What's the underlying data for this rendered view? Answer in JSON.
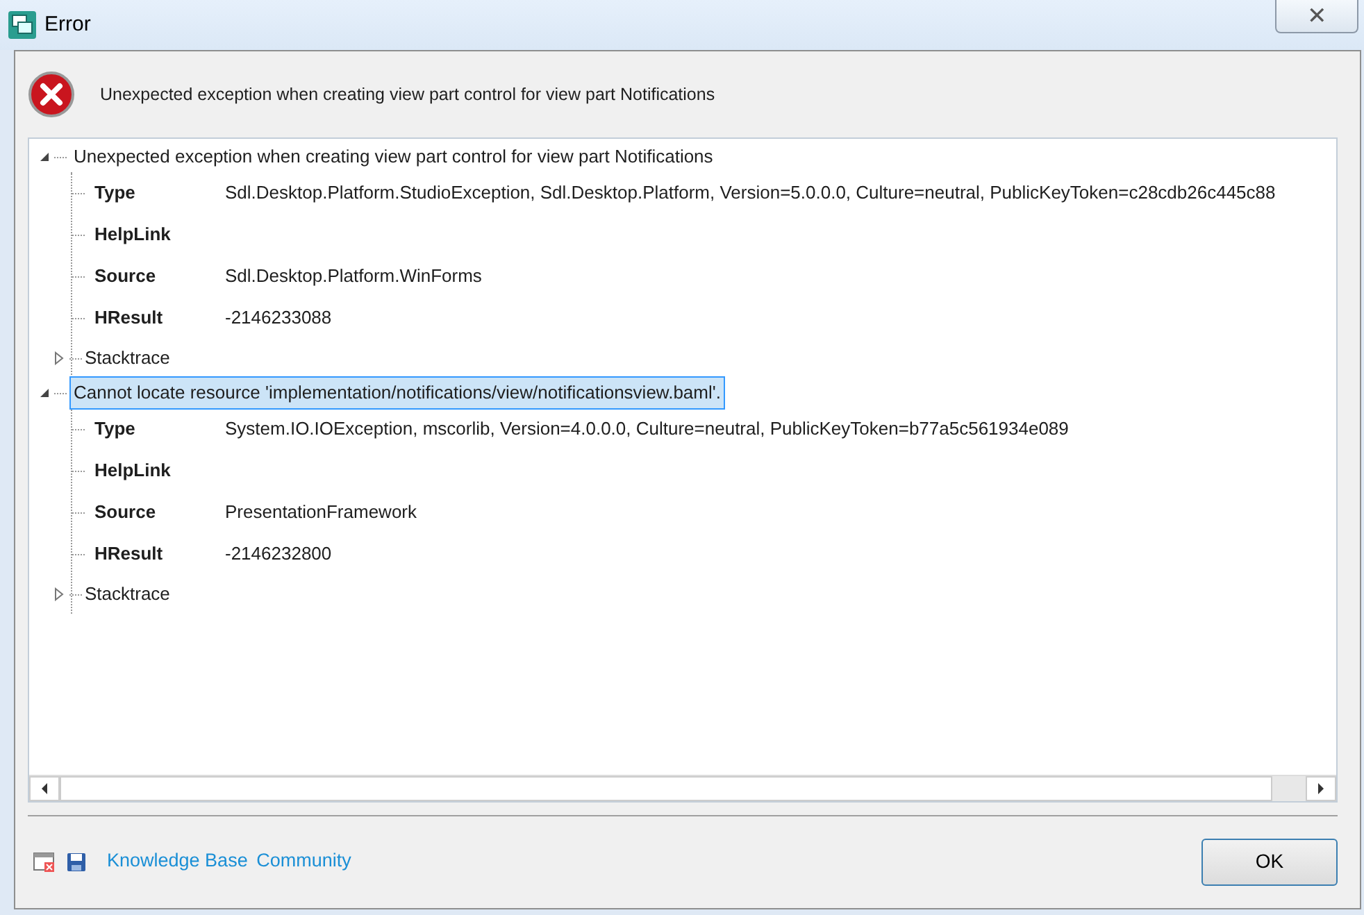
{
  "window": {
    "title": "Error",
    "close_label": "✕"
  },
  "message": "Unexpected exception when creating view part control for view part Notifications",
  "tree": [
    {
      "label": "Unexpected exception when creating view part control for view part Notifications",
      "expanded": true,
      "selected": false,
      "properties": [
        {
          "key": "Type",
          "value": "Sdl.Desktop.Platform.StudioException, Sdl.Desktop.Platform, Version=5.0.0.0, Culture=neutral, PublicKeyToken=c28cdb26c445c88"
        },
        {
          "key": "HelpLink"
        },
        {
          "key": "Source",
          "value": "Sdl.Desktop.Platform.WinForms"
        },
        {
          "key": "HResult",
          "value": "-2146233088"
        }
      ],
      "stacktrace": {
        "label": "Stacktrace",
        "expanded": false
      }
    },
    {
      "label": "Cannot locate resource 'implementation/notifications/view/notificationsview.baml'.",
      "expanded": true,
      "selected": true,
      "properties": [
        {
          "key": "Type",
          "value": "System.IO.IOException, mscorlib, Version=4.0.0.0, Culture=neutral, PublicKeyToken=b77a5c561934e089"
        },
        {
          "key": "HelpLink"
        },
        {
          "key": "Source",
          "value": "PresentationFramework"
        },
        {
          "key": "HResult",
          "value": "-2146232800"
        }
      ],
      "stacktrace": {
        "label": "Stacktrace",
        "expanded": false
      }
    }
  ],
  "footer": {
    "links": [
      "Knowledge Base",
      "Community"
    ],
    "ok_button": "OK"
  }
}
